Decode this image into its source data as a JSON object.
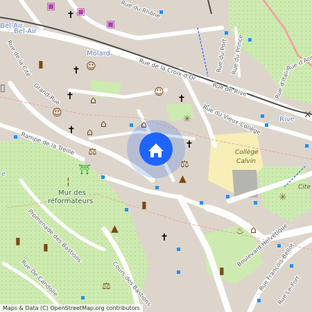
{
  "map": {
    "streets": [
      "Rue du Rhône",
      "Rue de la Croix-d'Or",
      "Rue de Rive",
      "Rue du Vieux-Collège",
      "Grand-Rue",
      "Rampe de la Treille",
      "Promenade des Bastions",
      "Rue De-Candolle",
      "Cours des Bastions",
      "Boulevard Helvétique",
      "Rue François-Bellot",
      "Rue du Port",
      "Rue du Prince",
      "Rue d'Italie",
      "Rue d'Aoste",
      "Rue de la Cité",
      "Rue Le-Fort"
    ],
    "areas": [
      "Bel-Air",
      "Molard",
      "Rive"
    ],
    "area_fragment": "Bel-Air",
    "school": [
      "Collège",
      "Calvin"
    ],
    "park_label": [
      "Mur des",
      "réformateurs"
    ],
    "edge_labels": [
      "Cite",
      "e"
    ],
    "location_marker": "home-marker",
    "colors": {
      "background": "#ddd5cb",
      "street": "#ffffff",
      "park": "#cdebb0",
      "marker": "#1e64ff",
      "poi": "#7a4a14",
      "church": "#000000",
      "school_area": "#f7efb7",
      "railway": "#4d4d4d",
      "bus_stop": "#1e90ff"
    }
  },
  "attribution": "Maps & Data (C) OpenStreetMap.org contributors"
}
